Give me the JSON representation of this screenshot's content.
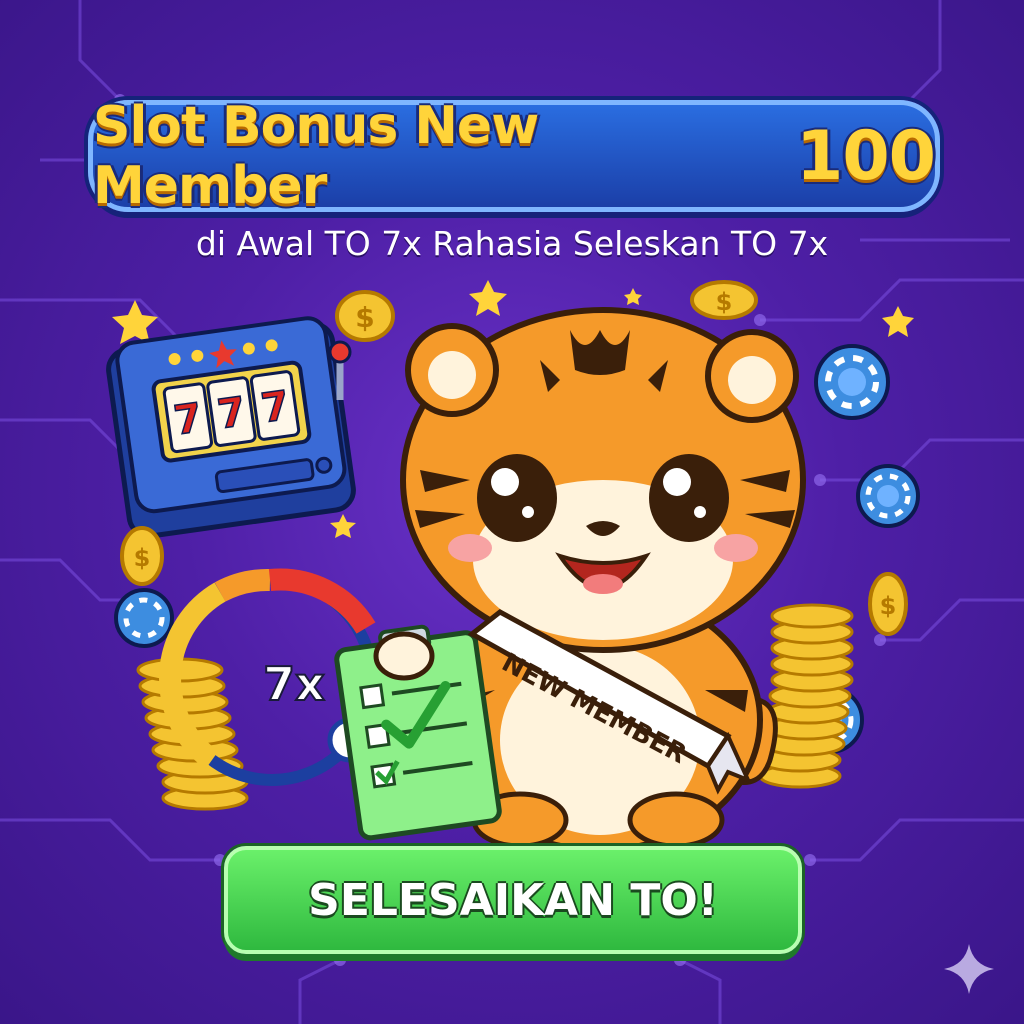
{
  "banner": {
    "title": "Slot Bonus New Member",
    "number": "100"
  },
  "subtitle": "di Awal TO 7x Rahasia Seleskan TO 7x",
  "slot_machine": {
    "reels": [
      "7",
      "7",
      "7"
    ]
  },
  "gauge": {
    "label": "7x"
  },
  "sash": {
    "text": "NEW MEMBER"
  },
  "cta": {
    "label": "SELESAIKAN TO!"
  },
  "icons": {
    "coin_symbol": "$",
    "sparkle": "sparkle-icon"
  },
  "colors": {
    "background": "#4e1fa6",
    "title_gold": "#ffd43a",
    "banner_blue": "#1b3fa8",
    "cta_green": "#2fb93f"
  }
}
